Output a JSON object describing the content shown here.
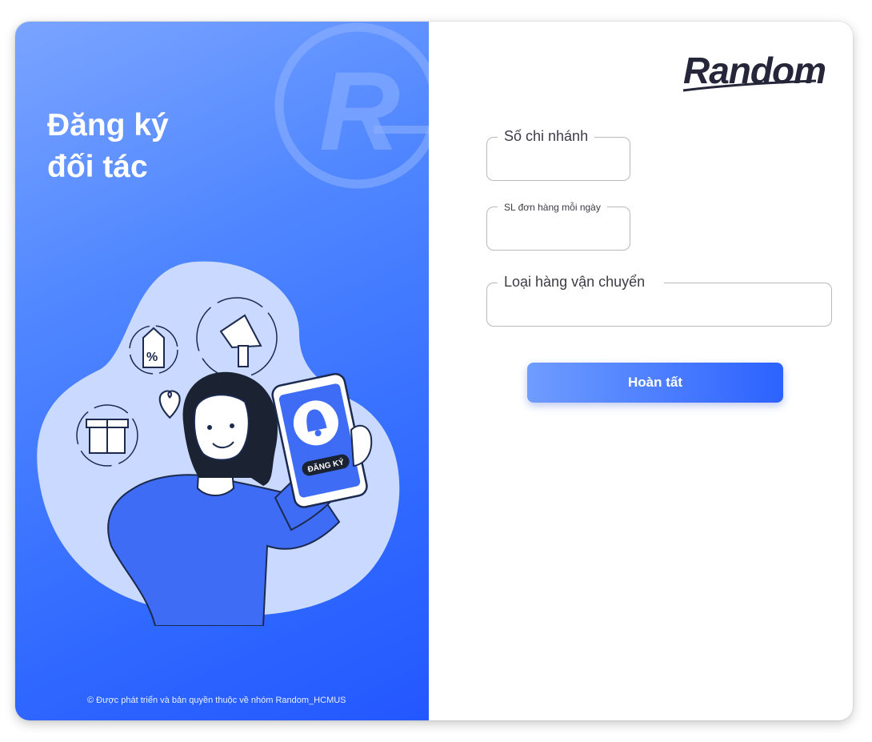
{
  "left_panel": {
    "title_line1": "Đăng ký",
    "title_line2": "đối tác",
    "footer": "© Được phát triển và bản quyền thuộc về nhóm Random_HCMUS",
    "phone_badge": "ĐĂNG KÝ",
    "watermark_letter": "R"
  },
  "right_panel": {
    "logo": "Random",
    "fields": {
      "branch_count": {
        "label": "Số chi nhánh",
        "value": ""
      },
      "daily_orders": {
        "label": "SL đơn hàng mỗi ngày",
        "value": ""
      },
      "shipping_type": {
        "label": "Loại hàng vận chuyển",
        "value": ""
      }
    },
    "submit_label": "Hoàn tất"
  },
  "colors": {
    "panel_gradient_start": "#7aa4ff",
    "panel_gradient_end": "#2457ff",
    "button_start": "#6f9cff",
    "button_end": "#2c62ff",
    "logo": "#26263a"
  }
}
